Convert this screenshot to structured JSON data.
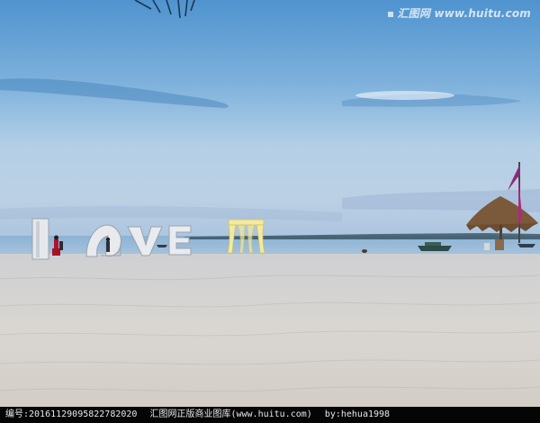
{
  "scene": {
    "description_name": "beach-love-sign",
    "letters": [
      "L",
      "O",
      "V",
      "E"
    ]
  },
  "watermark": {
    "top_text": "汇图网 www.huitu.com"
  },
  "footer": {
    "id_label": "编号:20161129095822782020",
    "site_label": "汇图网正版商业图库(www.huitu.com)",
    "author_label": "by:hehua1998"
  },
  "colors": {
    "sky_top": "#5b9bd1",
    "sky_mid": "#a9c9e2",
    "sea": "#7eaacd",
    "sand": "#d8d6d3",
    "footer_bg": "#050505"
  }
}
